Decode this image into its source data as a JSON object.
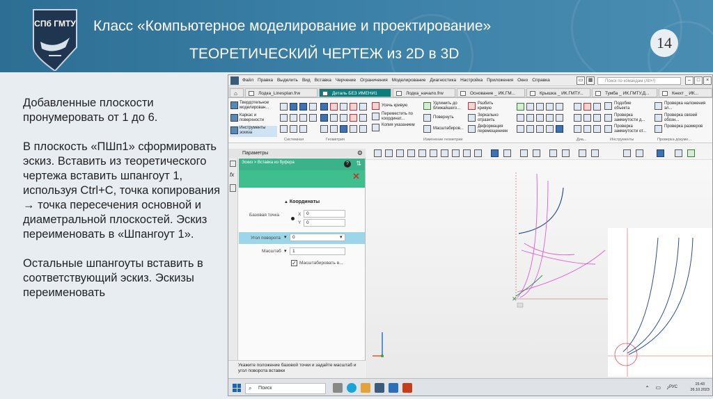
{
  "header": {
    "title": "Класс «Компьютерное моделирование и проектирование»",
    "subtitle": "ТЕОРЕТИЧЕСКИЙ ЧЕРТЕЖ из 2D в 3D",
    "page_number": "14",
    "logo_text": "СПб ГМТУ"
  },
  "instructions": {
    "p1": "Добавленные плоскости пронумеровать от 1 до 6.",
    "p2": "В плоскость «ПШп1» сформировать эскиз. Вставить из теоретического чертежа вставить шпангоут 1, используя Ctrl+C, точка копирования → точка пересечения основной и диаметральной плоскостей. Эскиз переименовать в «Шпангоут 1».",
    "p3": "Остальные шпангоуты вставить в соответствующий эскиз. Эскизы переименовать"
  },
  "app": {
    "menu": [
      "Файл",
      "Правка",
      "Выделить",
      "Вид",
      "Вставка",
      "Черчение",
      "Ограничения",
      "Моделирование",
      "Диагностика",
      "Настройка",
      "Приложения",
      "Окно",
      "Справка"
    ],
    "search_placeholder": "Поиск по командам (Alt+/)",
    "tabs": [
      {
        "label": "Лодка_Linesplan.frw"
      },
      {
        "label": "Деталь БЕЗ ИМЕНИ1"
      },
      {
        "label": "Лодка_начало.frw"
      },
      {
        "label": "Основание _ ИК.ГМ..."
      },
      {
        "label": "Крышка _ ИК.ГМТУ..."
      },
      {
        "label": "Тумба _ ИК.ГМТУ.Д..."
      },
      {
        "label": "Кнехт _ ИК..."
      }
    ],
    "ribbon": {
      "side_items": [
        "Твердотельное моделирован...",
        "Каркас и поверхности",
        "Инструменты эскиза"
      ],
      "commands": [
        "Усечь кривую",
        "Переместить по координат...",
        "Копия указанием",
        "Удлинить до ближайшего...",
        "Повернуть",
        "Масштабиров...",
        "Разбить кривую",
        "Зеркально отразить",
        "Деформация перемещением",
        "Подобие объекта",
        "Проверка замкнутости д...",
        "Проверка замкнутости от...",
        "Проверка наложения эл...",
        "Проверка связей обозн...",
        "Проверка размеров"
      ],
      "groups": [
        "Системная",
        "Геометрия",
        "Изменение геометрии",
        "Диа...",
        "Инструменты",
        "Проверка докуме..."
      ]
    },
    "params": {
      "panel_title": "Параметры",
      "breadcrumb": "Эскиз > Вставка из буфера",
      "section": "Координаты",
      "base_point_label": "Базовая точка",
      "x_label": "X",
      "x_value": "0",
      "y_label": "Y",
      "y_value": "0",
      "angle_label": "Угол поворота",
      "angle_value": "0",
      "scale_label": "Масштаб",
      "scale_value": "1",
      "scale_checkbox_label": "Масштабировать в..."
    },
    "hint": "Укажите положение базовой точки и задайте масштаб и угол поворота вставки",
    "taskbar": {
      "search_label": "Поиск",
      "lang": "РУС",
      "time": "15:43",
      "date": "26.10.2023"
    }
  },
  "colors": {
    "banner": "#3a7fa6",
    "accent_teal": "#3bb38a",
    "curve_blue": "#2b4f8f",
    "curve_magenta": "#e05ad0"
  }
}
